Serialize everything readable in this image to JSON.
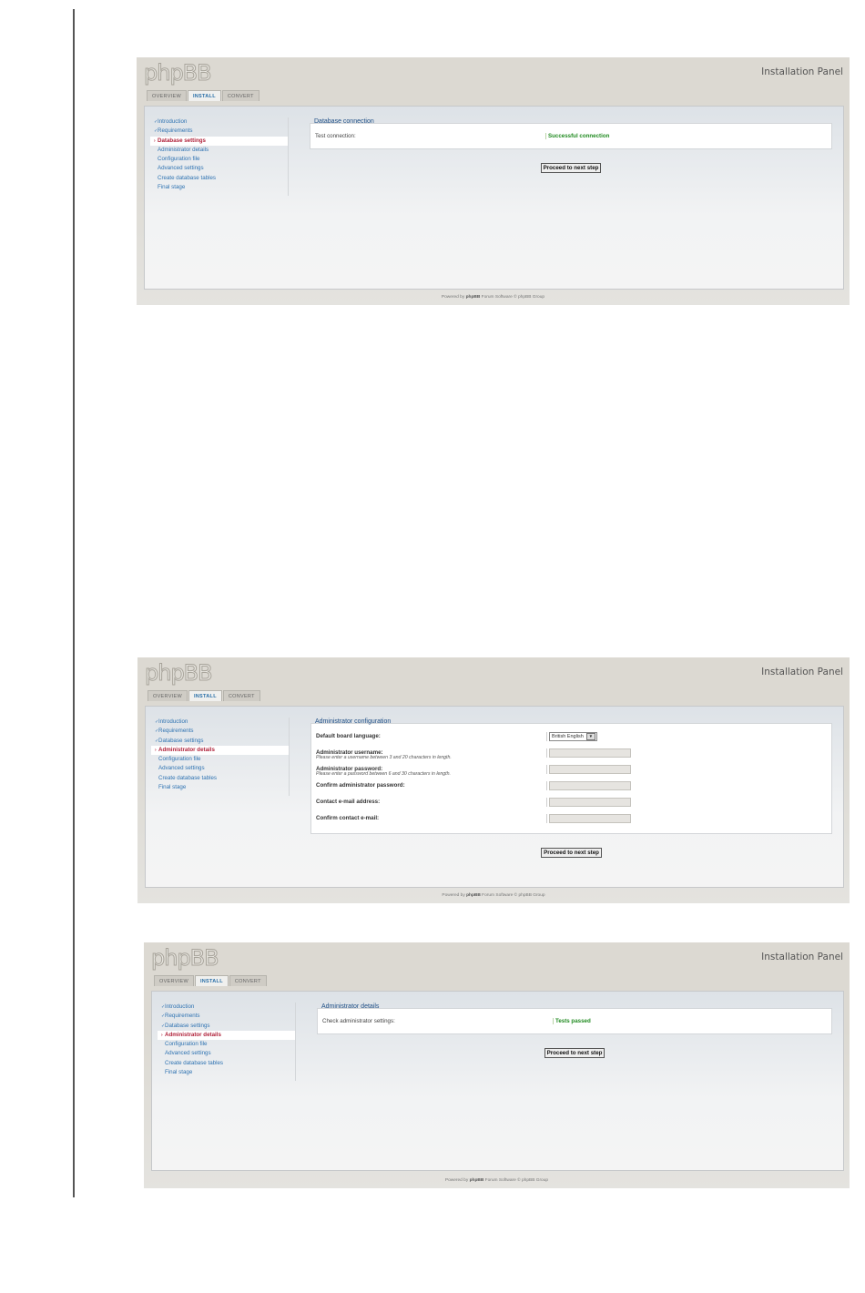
{
  "common": {
    "logo": "phpBB",
    "panel_title": "Installation Panel",
    "tabs": [
      "OVERVIEW",
      "INSTALL",
      "CONVERT"
    ],
    "footer_prefix": "Powered by",
    "footer_brand": "phpBB",
    "footer_suffix": "Forum Software © phpBB Group",
    "proceed_button": "Proceed to next step"
  },
  "shot1": {
    "nav": [
      "Introduction",
      "Requirements",
      "Database settings",
      "Administrator details",
      "Configuration file",
      "Advanced settings",
      "Create database tables",
      "Final stage"
    ],
    "legend": "Database connection",
    "row_label": "Test connection:",
    "row_value": "Successful connection"
  },
  "shot2": {
    "nav": [
      "Introduction",
      "Requirements",
      "Database settings",
      "Administrator details",
      "Configuration file",
      "Advanced settings",
      "Create database tables",
      "Final stage"
    ],
    "legend": "Administrator configuration",
    "fields": [
      {
        "label": "Default board language:",
        "hint": "",
        "value": "British English"
      },
      {
        "label": "Administrator username:",
        "hint": "Please enter a username between 3 and 20 characters in length."
      },
      {
        "label": "Administrator password:",
        "hint": "Please enter a password between 6 and 30 characters in length."
      },
      {
        "label": "Confirm administrator password:",
        "hint": ""
      },
      {
        "label": "Contact e-mail address:",
        "hint": ""
      },
      {
        "label": "Confirm contact e-mail:",
        "hint": ""
      }
    ]
  },
  "shot3": {
    "nav": [
      "Introduction",
      "Requirements",
      "Database settings",
      "Administrator details",
      "Configuration file",
      "Advanced settings",
      "Create database tables",
      "Final stage"
    ],
    "legend": "Administrator details",
    "row_label": "Check administrator settings:",
    "row_value": "Tests passed"
  },
  "colors": {
    "link": "#2f73b2",
    "current": "#b0223a",
    "success": "#1f8a1f",
    "legend": "#1f4f86"
  }
}
